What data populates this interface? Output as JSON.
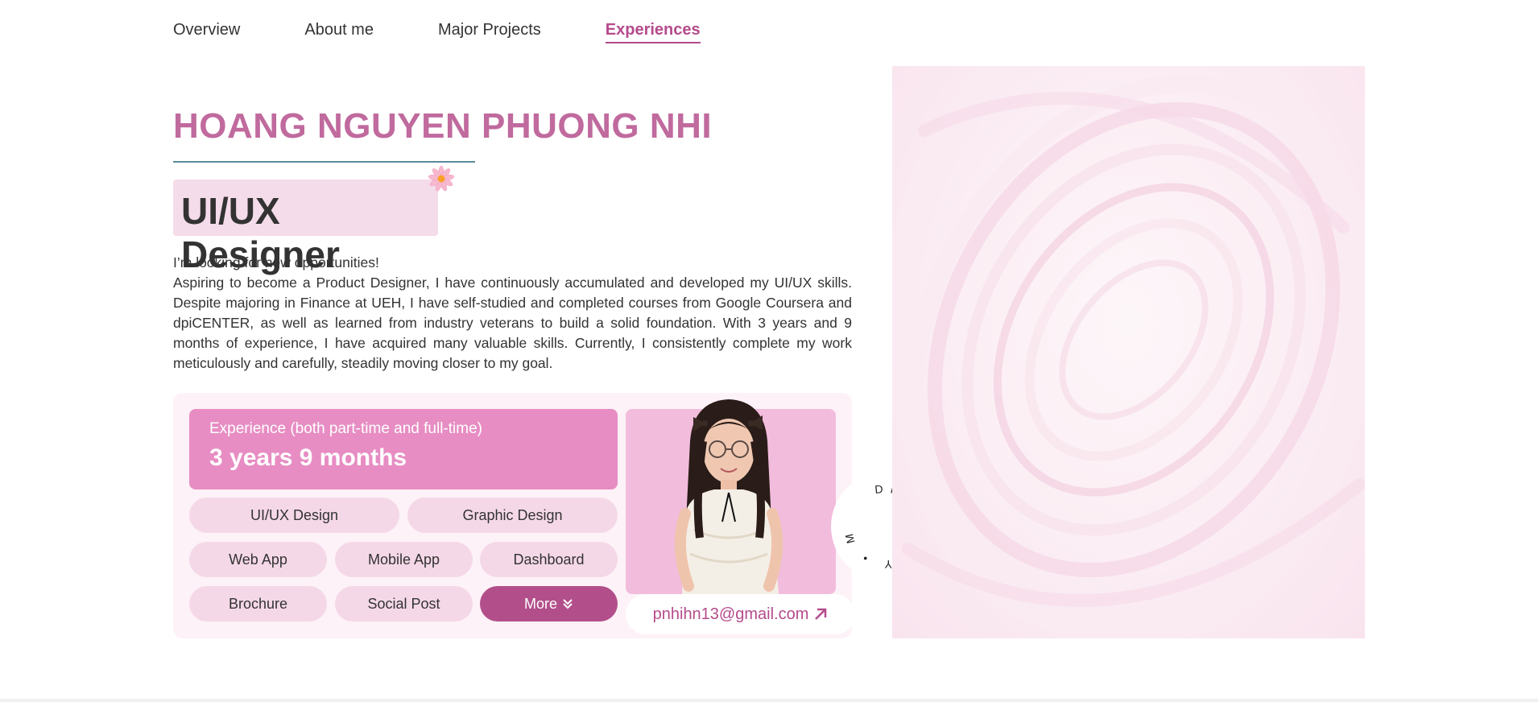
{
  "nav": {
    "items": [
      {
        "label": "Overview"
      },
      {
        "label": "About me"
      },
      {
        "label": "Major Projects"
      },
      {
        "label": "Experiences"
      }
    ],
    "active": "Experiences"
  },
  "hero": {
    "name": "HOANG NGUYEN PHUONG NHI",
    "role": "UI/UX Designer",
    "intro_line1": "I’m looking for new opportunities!",
    "intro_body": "Aspiring to become a Product Designer, I have continuously accumulated and developed my UI/UX skills. Despite majoring in Finance at UEH, I have self-studied and completed courses from Google Coursera and dpiCENTER, as well as learned from industry veterans to build a solid foundation. With 3 years and 9 months of experience, I have acquired many valuable skills. Currently, I consistently complete my work meticulously and carefully, steadily moving closer to my goal."
  },
  "experience": {
    "label": "Experience (both part-time and full-time)",
    "value": "3 years 9 months"
  },
  "tags": {
    "row1": [
      "UI/UX Design",
      "Graphic Design"
    ],
    "row2": [
      "Web App",
      "Mobile App",
      "Dashboard"
    ],
    "row3": [
      "Brochure",
      "Social Post"
    ],
    "more_label": "More"
  },
  "contact": {
    "email": "pnhihn13@gmail.com"
  },
  "discover_badge": {
    "text": "DISCOVERY • MORE • "
  },
  "colors": {
    "accent": "#b54b8c",
    "name_pink": "#c06a9e",
    "exp_box": "#e78dc3",
    "tag_bg": "#f5d8e8",
    "photo_bg": "#f2bcdc"
  },
  "icons": {
    "flower": "flower-icon",
    "more": "double-chevron-down-icon",
    "email": "arrow-up-right-icon"
  }
}
